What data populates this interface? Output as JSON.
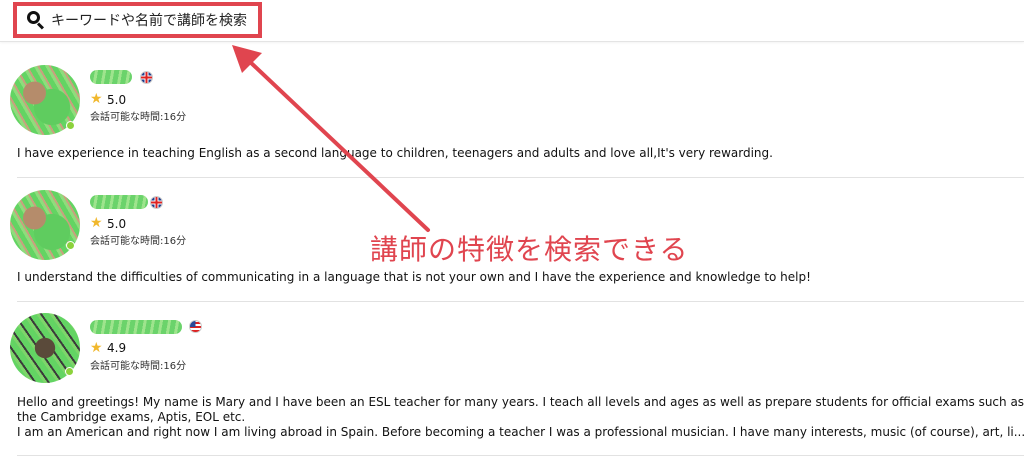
{
  "search": {
    "placeholder": "キーワードや名前で講師を検索",
    "icon": "search-icon"
  },
  "teachers": [
    {
      "flag": "uk",
      "rating": "5.0",
      "availability": "会話可能な時間:16分",
      "bio": [
        "I have experience in teaching English as a second language to children, teenagers and adults and love all,It's very rewarding."
      ]
    },
    {
      "flag": "uk",
      "rating": "5.0",
      "availability": "会話可能な時間:16分",
      "bio": [
        "I understand the difficulties of communicating in a language that is not your own and I have the experience and knowledge to help!"
      ]
    },
    {
      "flag": "us",
      "rating": "4.9",
      "availability": "会話可能な時間:16分",
      "bio": [
        "Hello and greetings! My name is Mary and I have been an ESL teacher for many years. I teach all levels and ages as well as prepare students for official exams such as",
        "the Cambridge exams, Aptis, EOL etc.",
        "I am an American and right now I am living abroad in Spain.   Before becoming a teacher I was a professional musician.  I have many interests, music (of course), art, li..."
      ]
    }
  ],
  "annotation": {
    "text": "講師の特徴を検索できる",
    "color": "#e0454f"
  }
}
